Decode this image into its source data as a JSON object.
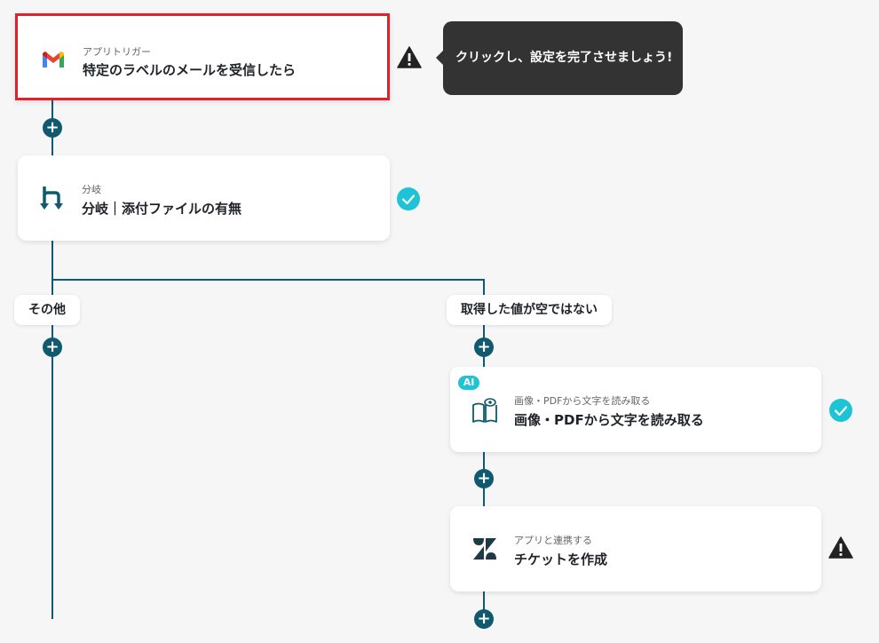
{
  "steps": {
    "trigger": {
      "sub": "アプリトリガー",
      "main": "特定のラベルのメールを受信したら"
    },
    "branch": {
      "sub": "分岐",
      "main": "分岐｜添付ファイルの有無"
    },
    "ocr": {
      "badge": "AI",
      "sub": "画像・PDFから文字を読み取る",
      "main": "画像・PDFから文字を読み取る"
    },
    "zendesk": {
      "sub": "アプリと連携する",
      "main": "チケットを作成"
    }
  },
  "tooltip": "クリックし、設定を完了させましょう!",
  "branches": {
    "left": "その他",
    "right": "取得した値が空ではない"
  },
  "plus_symbol": "+",
  "colors": {
    "line": "#0f5a6e",
    "selected_border": "#e0202a",
    "check": "#1ec3d6",
    "warning": "#222222",
    "tooltip_bg": "#333333"
  },
  "icons": {
    "trigger": "gmail-icon",
    "branch": "branch-icon",
    "ocr": "ocr-book-eye-icon",
    "zendesk": "zendesk-icon",
    "warning": "warning-icon",
    "check": "check-circle-icon",
    "plus": "plus-icon"
  }
}
